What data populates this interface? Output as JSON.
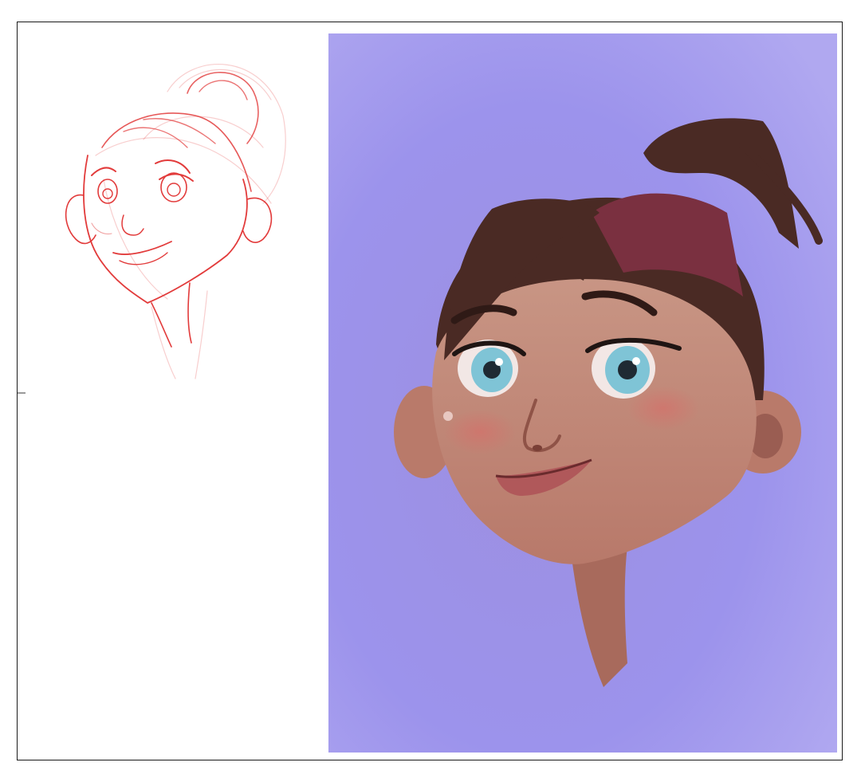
{
  "canvas": {
    "background_color": "#ffffff",
    "frame_color": "#1a1a1a"
  },
  "sketch": {
    "description_icon": "red-pencil-sketch-face",
    "stroke_color": "#e23b3b"
  },
  "painting": {
    "description_icon": "painted-girl-portrait",
    "background_color": "#9f95ec",
    "skin_color": "#c48978",
    "hair_color": "#4a2a24",
    "headband_color": "#7a3040",
    "eye_color": "#7fc4d6",
    "lip_color": "#b0585a"
  }
}
